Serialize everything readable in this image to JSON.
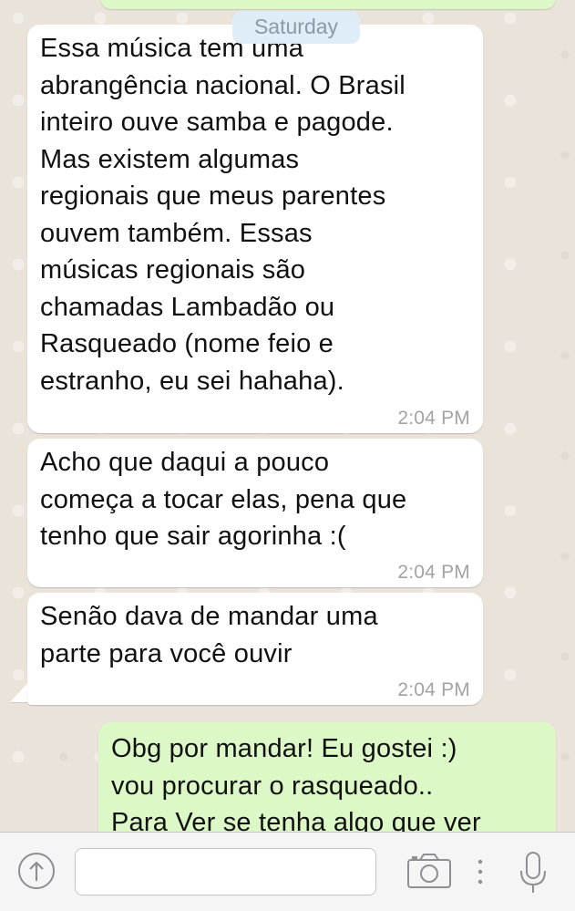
{
  "date_separator": "Saturday",
  "messages": [
    {
      "direction": "incoming",
      "text": "Essa música tem uma\nabrangência nacional. O Brasil\ninteiro ouve samba e pagode.\nMas existem algumas\nregionais que meus parentes\nouvem também. Essas\nmúsicas regionais são\nchamadas Lambadão ou\nRasqueado (nome feio e\nestranho, eu sei hahaha).",
      "time": "2:04 PM"
    },
    {
      "direction": "incoming",
      "text": "Acho que daqui a pouco\ncomeça a tocar elas, pena que\ntenho que sair agorinha :(",
      "time": "2:04 PM"
    },
    {
      "direction": "incoming",
      "text": "Senão dava de mandar uma\nparte para você ouvir",
      "time": "2:04 PM"
    },
    {
      "direction": "outgoing",
      "text": "Obg por mandar! Eu gostei :)\nvou procurar o rasqueado..\nPara Ver se tenha algo que ver"
    }
  ],
  "input_bar": {
    "text_value": "",
    "icons": {
      "share": "share-icon",
      "camera": "camera-icon",
      "separator": "vertical-dots",
      "mic": "microphone-icon"
    }
  },
  "colors": {
    "chat_background": "#e9e3da",
    "incoming_bubble": "#ffffff",
    "outgoing_bubble": "#dcf8c6",
    "timestamp": "#a3a3a3",
    "date_pill": "#ddecf8",
    "input_bar": "#f5f5f6",
    "icon_gray": "#8e8e93"
  }
}
